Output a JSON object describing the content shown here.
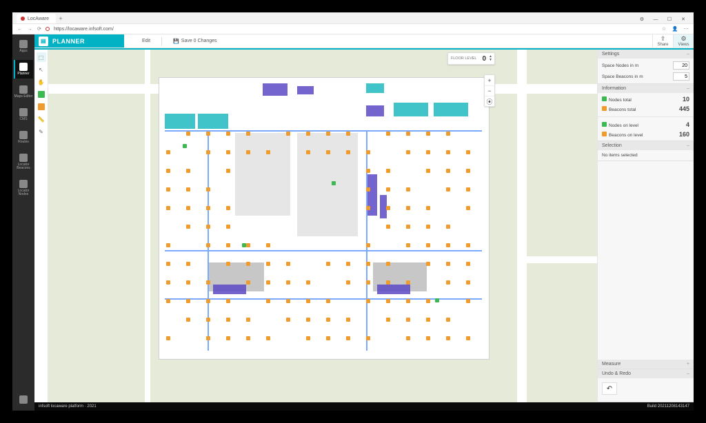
{
  "browser": {
    "tab_title": "LocAware",
    "url": "https://locaware.infsoft.com/",
    "new_tab": "+",
    "window_buttons": {
      "min": "—",
      "max": "☐",
      "close": "✕"
    }
  },
  "left_rail": {
    "items": [
      {
        "label": "Apps"
      },
      {
        "label": "Planner"
      },
      {
        "label": "Maps Editor"
      },
      {
        "label": "CMS"
      },
      {
        "label": "Routes"
      },
      {
        "label": "Locator Beacons"
      },
      {
        "label": "Locator Nodes"
      }
    ]
  },
  "titlebar": {
    "app": "PLANNER",
    "edit": "Edit",
    "save": "Save 0 Changes",
    "share": "Share",
    "views": "Views"
  },
  "floor": {
    "label": "FLOOR LEVEL",
    "value": "0"
  },
  "zoom": {
    "plus": "+",
    "minus": "−",
    "locate": "⦿"
  },
  "panels": {
    "settings": {
      "title": "Settings",
      "rows": [
        {
          "label": "Space Nodes in m",
          "value": "20"
        },
        {
          "label": "Space Beacons in m",
          "value": "5"
        }
      ]
    },
    "information": {
      "title": "Information",
      "total": [
        {
          "label": "Nodes total",
          "value": "10"
        },
        {
          "label": "Beacons total",
          "value": "445"
        }
      ],
      "level": [
        {
          "label": "Nodes on level",
          "value": "4"
        },
        {
          "label": "Beacons on level",
          "value": "160"
        }
      ]
    },
    "selection": {
      "title": "Selection",
      "empty": "No items selected"
    },
    "measure": {
      "title": "Measure"
    },
    "undoredo": {
      "title": "Undo & Redo",
      "undo": "↶"
    }
  },
  "status": {
    "left": "infsoft locaware platform · 2021",
    "right": "Build 20211208143147"
  },
  "colors": {
    "accent": "#00b2c4",
    "node_green": "#3cb950",
    "beacon_orange": "#ef9b2d"
  }
}
